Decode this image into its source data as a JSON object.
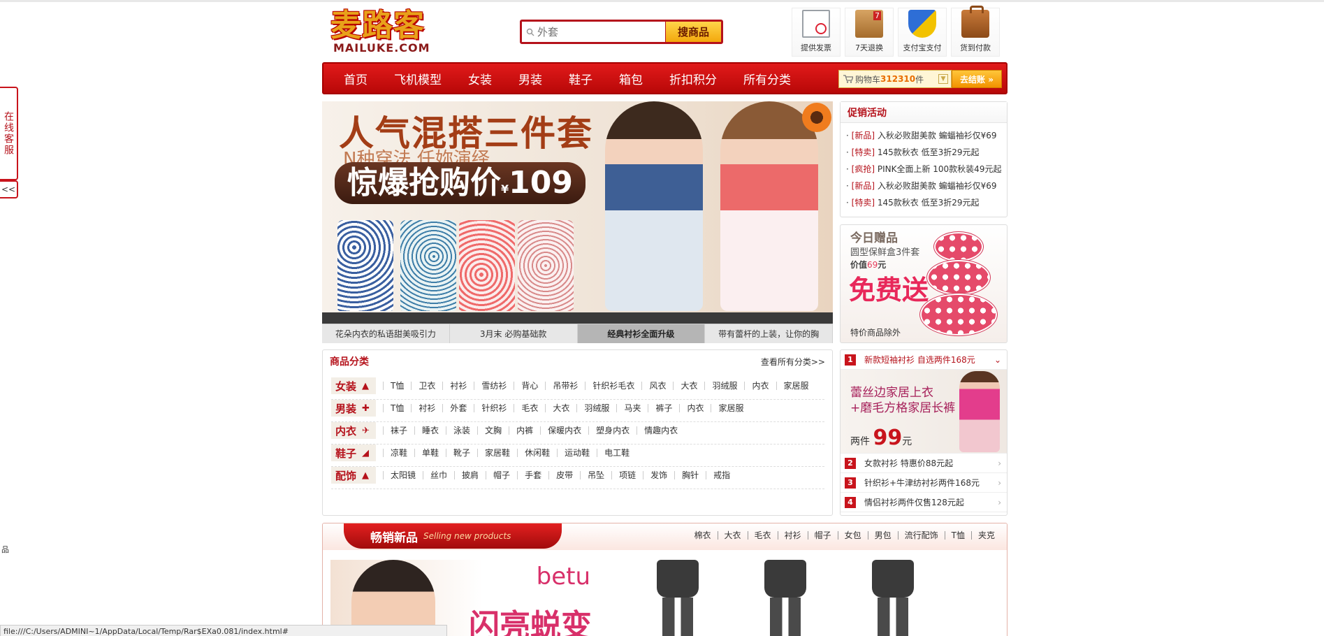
{
  "logo": {
    "cn": "麦路客",
    "en": "MAILUKE.COM"
  },
  "search": {
    "placeholder": "外套",
    "button": "搜商品"
  },
  "services": [
    {
      "icon": "invoice-icon",
      "label": "提供发票"
    },
    {
      "icon": "return-box-icon",
      "label": "7天退换"
    },
    {
      "icon": "alipay-shield-icon",
      "label": "支付宝支付"
    },
    {
      "icon": "cod-bag-icon",
      "label": "货到付款"
    }
  ],
  "nav": [
    "首页",
    "飞机模型",
    "女装",
    "男装",
    "鞋子",
    "箱包",
    "折扣积分",
    "所有分类"
  ],
  "cart": {
    "prefix": "购物车",
    "count": "312310",
    "suffix": "件",
    "checkout": "去结账 »"
  },
  "banner": {
    "headline": "人气混搭三件套",
    "subline": "N种穿法 任妳演绎",
    "price_label": "惊爆抢购价",
    "currency": "¥",
    "price": "109",
    "tabs": [
      "花朵内衣的私语甜美吸引力",
      "3月末 必购基础款",
      "经典衬衫全面升级",
      "带有蕾杆的上装，让你的胸"
    ],
    "active_tab": 2
  },
  "promo": {
    "title": "促销活动",
    "items": [
      {
        "tag": "[新品]",
        "text": "入秋必败甜美款 蝙蝠袖衫仅¥69"
      },
      {
        "tag": "[特卖]",
        "text": "145款秋衣 低至3折29元起"
      },
      {
        "tag": "[疯抢]",
        "text": "PINK全面上新 100款秋装49元起"
      },
      {
        "tag": "[新品]",
        "text": "入秋必败甜美款 蝙蝠袖衫仅¥69"
      },
      {
        "tag": "[特卖]",
        "text": "145款秋衣 低至3折29元起"
      }
    ]
  },
  "gift": {
    "title": "今日赠品",
    "product": "圆型保鲜盒3件套",
    "value_prefix": "价值",
    "value": "69",
    "value_unit": "元",
    "free": "免费送",
    "note": "特价商品除外"
  },
  "category": {
    "title": "商品分类",
    "more": "查看所有分类>>",
    "rows": [
      {
        "name": "女装",
        "icon": "dress-icon",
        "items": [
          "T恤",
          "卫衣",
          "衬衫",
          "雪纺衫",
          "背心",
          "吊带衫",
          "针织衫毛衣",
          "风衣",
          "大衣",
          "羽绒服",
          "内衣",
          "家居服"
        ]
      },
      {
        "name": "男装",
        "icon": "shirt-icon",
        "items": [
          "T恤",
          "衬衫",
          "外套",
          "针织衫",
          "毛衣",
          "大衣",
          "羽绒服",
          "马夹",
          "裤子",
          "内衣",
          "家居服"
        ]
      },
      {
        "name": "内衣",
        "icon": "lingerie-icon",
        "items": [
          "袜子",
          "睡衣",
          "泳装",
          "文胸",
          "内裤",
          "保暖内衣",
          "塑身内衣",
          "情趣内衣"
        ]
      },
      {
        "name": "鞋子",
        "icon": "shoe-icon",
        "items": [
          "凉鞋",
          "单鞋",
          "靴子",
          "家居鞋",
          "休闲鞋",
          "运动鞋",
          "电工鞋"
        ]
      },
      {
        "name": "配饰",
        "icon": "accessory-icon",
        "items": [
          "太阳镜",
          "丝巾",
          "披肩",
          "帽子",
          "手套",
          "皮带",
          "吊坠",
          "项链",
          "发饰",
          "胸针",
          "戒指"
        ]
      }
    ]
  },
  "rank": {
    "first": {
      "num": "1",
      "text": "新款短袖衬衫 自选两件168元"
    },
    "feature": {
      "line1": "蕾丝边家居上衣",
      "line2": "+磨毛方格家居长裤",
      "prefix": "两件",
      "price": "99",
      "unit": "元"
    },
    "others": [
      {
        "num": "2",
        "text": "女款衬衫 特惠价88元起"
      },
      {
        "num": "3",
        "text": "针织衫+牛津纺衬衫两件168元"
      },
      {
        "num": "4",
        "text": "情侣衬衫两件仅售128元起"
      }
    ]
  },
  "hot": {
    "title": "畅销新品",
    "subtitle": "Selling new products",
    "tags": [
      "棉衣",
      "大衣",
      "毛衣",
      "衬衫",
      "帽子",
      "女包",
      "男包",
      "流行配饰",
      "T恤",
      "夹克"
    ],
    "brand": "betu",
    "slogan": "闪亮蜕变"
  },
  "side": {
    "label": "在线客服",
    "collapse": "<<"
  },
  "tiny_label": "品",
  "status_bar": "file:///C:/Users/ADMINI~1/AppData/Local/Temp/Rar$EXa0.081/index.html#"
}
